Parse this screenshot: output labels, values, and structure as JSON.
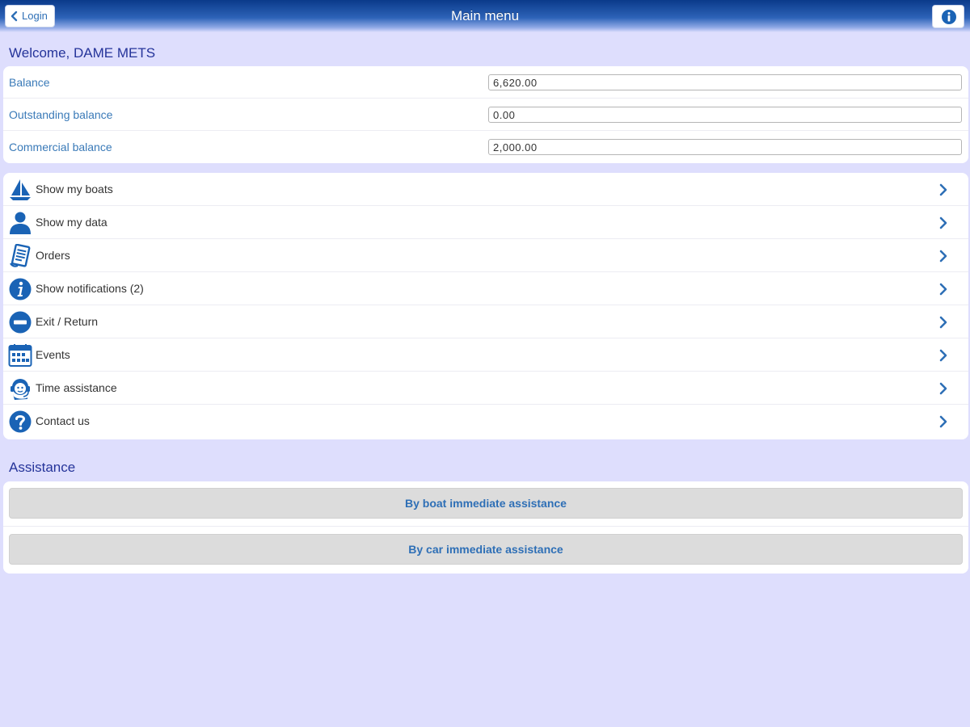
{
  "header": {
    "title": "Main menu",
    "back_label": "Login"
  },
  "welcome": "Welcome, DAME METS",
  "balances": [
    {
      "label": "Balance",
      "value": "6,620.00"
    },
    {
      "label": "Outstanding balance",
      "value": "0.00"
    },
    {
      "label": "Commercial balance",
      "value": "2,000.00"
    }
  ],
  "menu": [
    {
      "label": "Show my boats",
      "icon": "sailboat-icon"
    },
    {
      "label": "Show my data",
      "icon": "user-icon"
    },
    {
      "label": "Orders",
      "icon": "document-icon"
    },
    {
      "label": "Show notifications (2)",
      "icon": "info-icon"
    },
    {
      "label": "Exit / Return",
      "icon": "minus-circle-icon"
    },
    {
      "label": "Events",
      "icon": "calendar-icon"
    },
    {
      "label": "Time assistance",
      "icon": "headset-icon"
    },
    {
      "label": "Contact us",
      "icon": "question-icon"
    }
  ],
  "assistance": {
    "title": "Assistance",
    "boat_label": "By boat immediate assistance",
    "car_label": "By car immediate assistance"
  },
  "colors": {
    "background": "#dedefd",
    "header": "#2d63b8",
    "accent": "#2e6fb6",
    "icon": "#1a63b5",
    "title_text": "#25349a"
  }
}
